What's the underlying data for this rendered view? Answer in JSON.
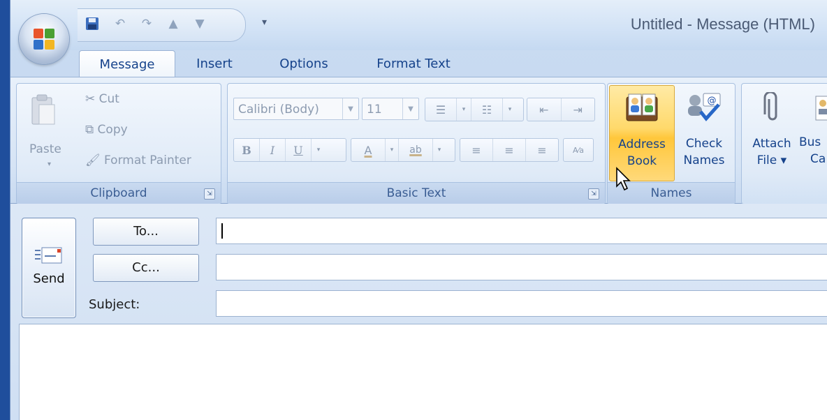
{
  "window": {
    "title": "Untitled - Message (HTML)"
  },
  "tabs": [
    "Message",
    "Insert",
    "Options",
    "Format Text"
  ],
  "clipboard": {
    "paste_label": "Paste",
    "cut_label": "Cut",
    "copy_label": "Copy",
    "format_painter_label": "Format Painter",
    "group_label": "Clipboard"
  },
  "basic_text": {
    "font_name": "Calibri (Body)",
    "font_size": "11",
    "bold": "B",
    "italic": "I",
    "underline": "U",
    "font_color": "A",
    "highlight": "ab",
    "group_label": "Basic Text"
  },
  "names": {
    "address_book_line1": "Address",
    "address_book_line2": "Book",
    "check_names_line1": "Check",
    "check_names_line2": "Names",
    "group_label": "Names"
  },
  "include": {
    "attach_file_line1": "Attach",
    "attach_file_line2": "File ▾",
    "business_card_line1": "Bus",
    "business_card_line2": "Ca"
  },
  "form": {
    "send_label": "Send",
    "to_label": "To...",
    "cc_label": "Cc...",
    "subject_label": "Subject:",
    "to_value": "",
    "cc_value": "",
    "subject_value": ""
  },
  "colors": {
    "accent": "#15428b",
    "hover_gold": "#ffd96b"
  }
}
